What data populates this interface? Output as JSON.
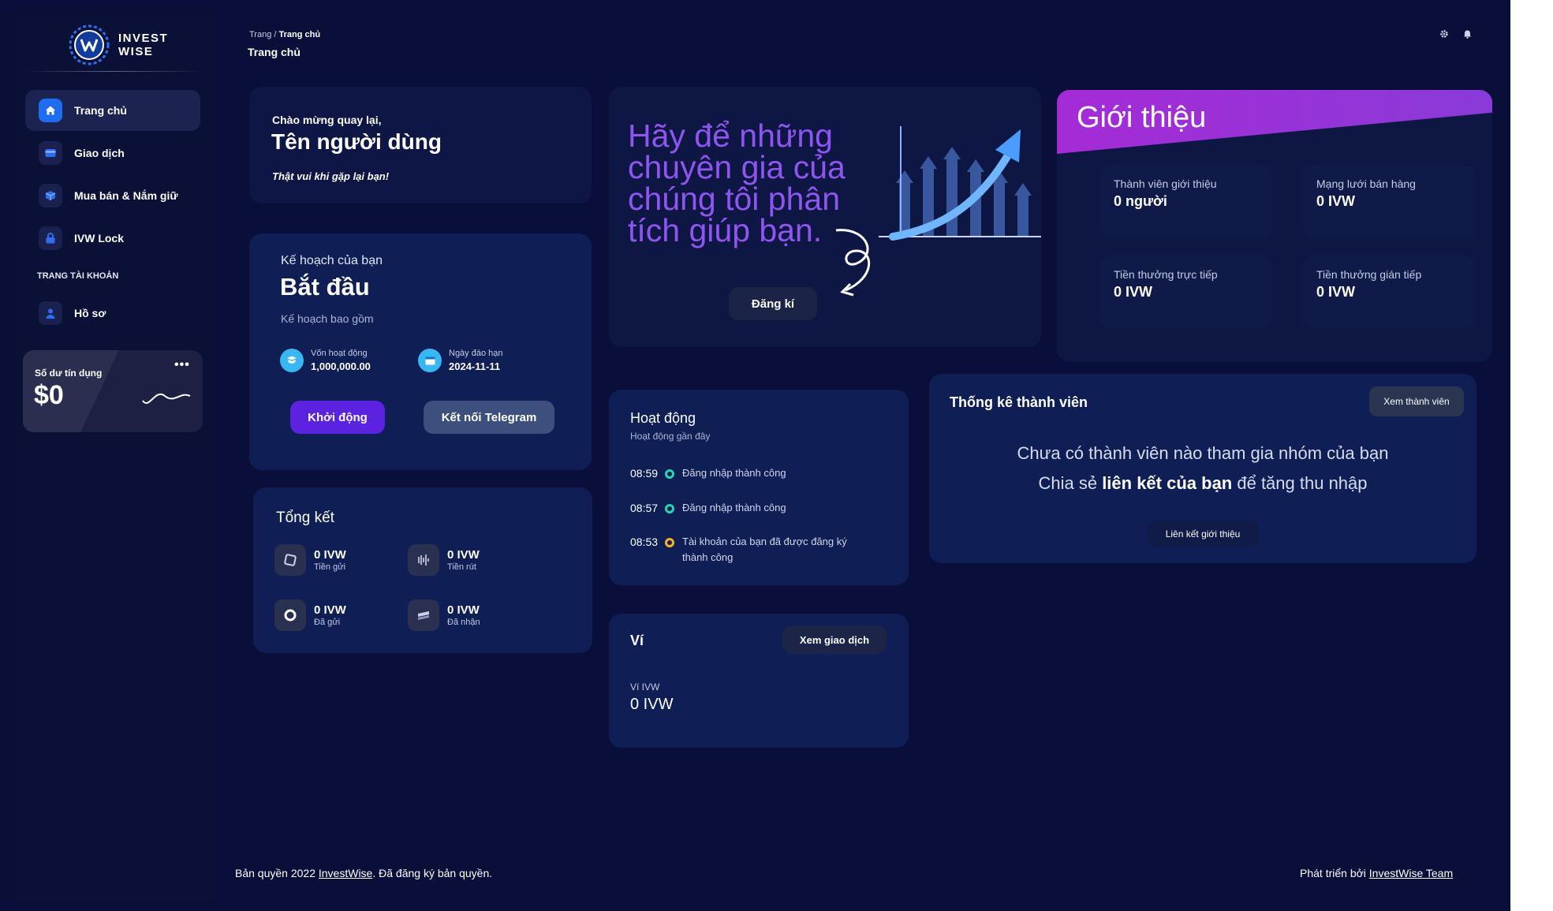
{
  "brand": {
    "line1": "INVEST",
    "line2": "WISE"
  },
  "sidebar": {
    "items": [
      {
        "label": "Trang chủ"
      },
      {
        "label": "Giao dịch"
      },
      {
        "label": "Mua bán & Nắm giữ"
      },
      {
        "label": "IVW Lock"
      }
    ],
    "section_label": "TRANG TÀI KHOẢN",
    "profile_label": "Hồ sơ",
    "credit": {
      "label": "Số dư tín dụng",
      "value": "$0",
      "menu": "•••"
    }
  },
  "header": {
    "breadcrumb_root": "Trang",
    "breadcrumb_sep": " / ",
    "breadcrumb_current": "Trang chủ",
    "title": "Trang chủ"
  },
  "welcome": {
    "greeting": "Chào mừng quay lại,",
    "name": "Tên người dùng",
    "subtitle": "Thật vui khi gặp lại bạn!"
  },
  "plan": {
    "heading": "Kế hoạch của bạn",
    "name": "Bắt đầu",
    "includes": "Kế hoạch bao gồm",
    "capital_label": "Vốn hoạt động",
    "capital_value": "1,000,000.00",
    "due_label": "Ngày đáo hạn",
    "due_value": "2024-11-11",
    "start_button": "Khởi động",
    "telegram_button": "Kết nối Telegram"
  },
  "summary": {
    "title": "Tổng kết",
    "items": [
      {
        "value": "0 IVW",
        "label": "Tiền gửi"
      },
      {
        "value": "0 IVW",
        "label": "Tiền rút"
      },
      {
        "value": "0 IVW",
        "label": "Đã gửi"
      },
      {
        "value": "0 IVW",
        "label": "Đã nhận"
      }
    ]
  },
  "promo": {
    "line1": "Hãy để những",
    "line2": "chuyên gia của",
    "line3": "chúng tôi phân",
    "line4": "tích giúp bạn.",
    "register_button": "Đăng kí"
  },
  "intro": {
    "title": "Giới thiệu",
    "stats": [
      {
        "label": "Thành viên giới thiệu",
        "value": "0 người"
      },
      {
        "label": "Mạng lưới bán hàng",
        "value": "0 IVW"
      },
      {
        "label": "Tiền thưởng trực tiếp",
        "value": "0 IVW"
      },
      {
        "label": "Tiền thưởng gián tiếp",
        "value": "0 IVW"
      }
    ]
  },
  "activity": {
    "title": "Hoạt động",
    "subtitle": "Hoạt động gần đây",
    "entries": [
      {
        "time": "08:59",
        "text": "Đăng nhập thành công",
        "color": "#27d3b3"
      },
      {
        "time": "08:57",
        "text": "Đăng nhập thành công",
        "color": "#27d3b3"
      },
      {
        "time": "08:53",
        "text": "Tài khoản của bạn đã được đăng ký thành công",
        "color": "#f5b224"
      }
    ]
  },
  "wallet": {
    "title": "Ví",
    "view_button": "Xem giao dịch",
    "label": "Ví IVW",
    "value": "0 IVW"
  },
  "members": {
    "title": "Thống kê thành viên",
    "view_button": "Xem thành viên",
    "empty_line1": "Chưa có thành viên nào tham gia nhóm của bạn",
    "empty_line2_pre": "Chia sẻ ",
    "empty_line2_bold": "liên kết của bạn",
    "empty_line2_post": " để tăng thu nhập",
    "link_button": "Liên kết giới thiệu"
  },
  "footer": {
    "copyright_pre": "Bản quyền 2022 ",
    "copyright_link": "InvestWise",
    "copyright_post": ". Đã đăng ký bản quyền.",
    "dev_pre": "Phát triển bởi ",
    "dev_link": "InvestWise Team"
  },
  "icons": {
    "nav": [
      "home-icon",
      "card-icon",
      "cube-icon",
      "lock-icon",
      "user-icon"
    ],
    "top": [
      "gear-icon",
      "bell-icon"
    ]
  },
  "colors": {
    "background": "#0a0f3a",
    "accent": "#5b23e0",
    "purple_text": "#8e55f1",
    "active_nav": "#1d6cf2"
  }
}
